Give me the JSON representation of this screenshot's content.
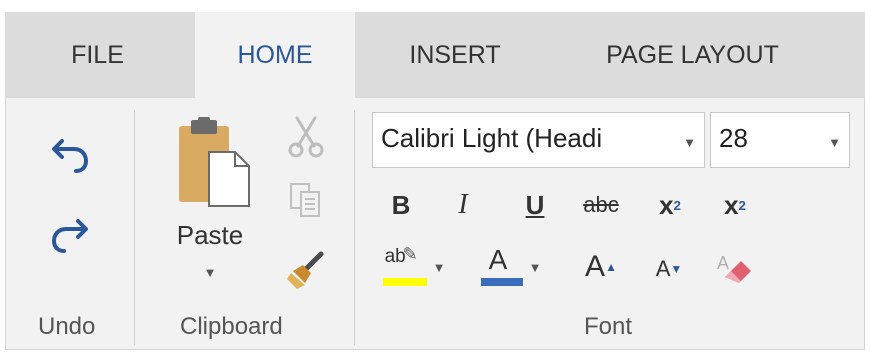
{
  "tabs": [
    {
      "label": "FILE",
      "active": false
    },
    {
      "label": "HOME",
      "active": true
    },
    {
      "label": "INSERT",
      "active": false
    },
    {
      "label": "PAGE LAYOUT",
      "active": false
    }
  ],
  "groups": {
    "undo": {
      "label": "Undo"
    },
    "clipboard": {
      "label": "Clipboard",
      "paste_label": "Paste"
    },
    "font": {
      "label": "Font",
      "font_name": "Calibri Light (Headi",
      "font_size": "28",
      "bold": "B",
      "italic": "I",
      "underline": "U",
      "strike": "abc",
      "subscript_base": "x",
      "subscript_mark": "2",
      "superscript_base": "x",
      "superscript_mark": "2",
      "grow_font": "A",
      "shrink_font": "A",
      "font_color_glyph": "A",
      "highlight_glyph": "ab"
    }
  },
  "colors": {
    "accent_blue": "#2b579a",
    "highlight_yellow": "#ffff00",
    "font_color_bar": "#3a6ebd",
    "eraser_pink": "#e06070",
    "clipboard_tan": "#d8aa62"
  }
}
